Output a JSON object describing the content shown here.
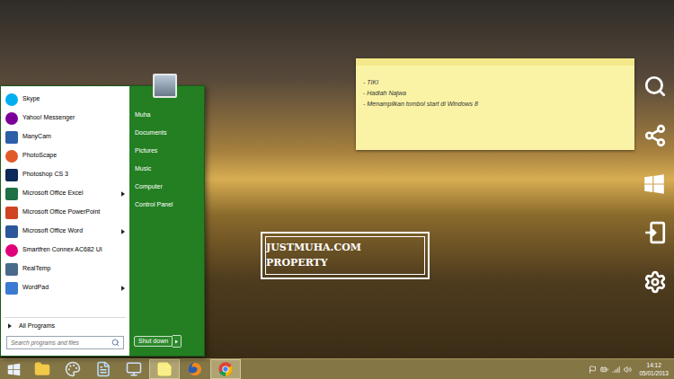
{
  "start_menu": {
    "programs": [
      {
        "label": "Skype",
        "kind": "skype",
        "has_submenu": false
      },
      {
        "label": "Yahoo! Messenger",
        "kind": "yahoo",
        "has_submenu": false
      },
      {
        "label": "ManyCam",
        "kind": "manycam",
        "has_submenu": false
      },
      {
        "label": "PhotoScape",
        "kind": "photoscape",
        "has_submenu": false
      },
      {
        "label": "Photoshop CS 3",
        "kind": "photoshop",
        "has_submenu": false
      },
      {
        "label": "Microsoft Office Excel",
        "kind": "excel",
        "has_submenu": true
      },
      {
        "label": "Microsoft Office PowerPoint",
        "kind": "powerpoint",
        "has_submenu": false
      },
      {
        "label": "Microsoft Office Word",
        "kind": "word",
        "has_submenu": true
      },
      {
        "label": "Smartfren Connex AC682 UI",
        "kind": "smartfren",
        "has_submenu": false
      },
      {
        "label": "RealTemp",
        "kind": "realtemp",
        "has_submenu": false
      },
      {
        "label": "WordPad",
        "kind": "wordpad",
        "has_submenu": true
      }
    ],
    "all_programs": "All Programs",
    "search_placeholder": "Search programs and files",
    "places": [
      "Muha",
      "Documents",
      "Pictures",
      "Music",
      "Computer",
      "Control Panel"
    ],
    "shutdown": "Shut down"
  },
  "sticky_note": {
    "lines": [
      "- TIKI",
      "- Hadiah Najwa",
      "- Menampilkan tombol start di Windows 8"
    ]
  },
  "watermark": "JUSTMUHA.COM PROPERTY",
  "taskbar": {
    "items": [
      {
        "kind": "explorer",
        "running": false
      },
      {
        "kind": "paint",
        "running": false
      },
      {
        "kind": "notepad",
        "running": false
      },
      {
        "kind": "computer",
        "running": false
      },
      {
        "kind": "sticky",
        "running": true
      },
      {
        "kind": "firefox",
        "running": false
      },
      {
        "kind": "chrome",
        "running": true
      }
    ],
    "time": "14:12",
    "date": "05/01/2013"
  }
}
